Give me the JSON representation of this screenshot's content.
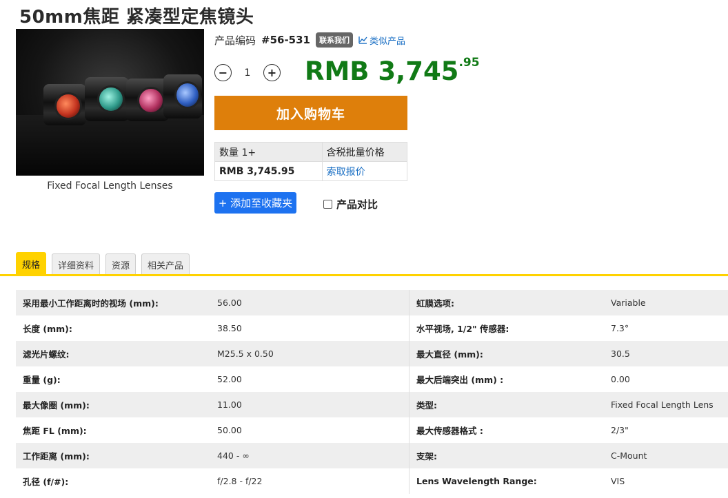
{
  "title": "50mm焦距 紧凑型定焦镜头",
  "image": {
    "caption": "Fixed Focal Length Lenses"
  },
  "product": {
    "code_label": "产品编码",
    "code_value": "#56-531",
    "contact_badge": "联系我们",
    "similar_link": "类似产品",
    "quantity": "1",
    "price_main": "RMB 3,745",
    "price_cents": ".95",
    "cart_button": "加入购物车",
    "favorite_button": "+ 添加至收藏夹",
    "compare_label": "产品对比"
  },
  "price_table": {
    "headers": [
      "数量 1+",
      "含税批量价格"
    ],
    "row": [
      "RMB 3,745.95",
      "索取报价"
    ]
  },
  "tabs": [
    {
      "label": "规格",
      "active": true
    },
    {
      "label": "详细资料",
      "active": false
    },
    {
      "label": "资源",
      "active": false
    },
    {
      "label": "相关产品",
      "active": false
    }
  ],
  "specs": [
    {
      "l1": "采用最小工作距离时的视场 (mm):",
      "v1": "56.00",
      "l2": "虹膜选项:",
      "v2": "Variable"
    },
    {
      "l1": "长度 (mm):",
      "v1": "38.50",
      "l2": "水平视场, 1/2\" 传感器:",
      "v2": "7.3°"
    },
    {
      "l1": "滤光片螺纹:",
      "v1": "M25.5 x 0.50",
      "l2": "最大直径 (mm):",
      "v2": "30.5"
    },
    {
      "l1": "重量 (g):",
      "v1": "52.00",
      "l2": "最大后端突出 (mm) :",
      "v2": "0.00"
    },
    {
      "l1": "最大像圈 (mm):",
      "v1": "11.00",
      "l2": "类型:",
      "v2": "Fixed Focal Length Lens"
    },
    {
      "l1": "焦距 FL (mm):",
      "v1": "50.00",
      "l2": "最大传感器格式 :",
      "v2": "2/3\""
    },
    {
      "l1": "工作距离 (mm):",
      "v1": "440 - ∞",
      "l2": "支架:",
      "v2": "C-Mount"
    },
    {
      "l1": "孔径 (f/#):",
      "v1": "f/2.8 - f/22",
      "l2": "Lens Wavelength Range:",
      "v2": "VIS"
    }
  ],
  "colors": {
    "price": "#117a16",
    "cart": "#de7f0b",
    "favorite": "#1d72f0",
    "tab_accent": "#ffd200",
    "link": "#1a6fc4"
  }
}
